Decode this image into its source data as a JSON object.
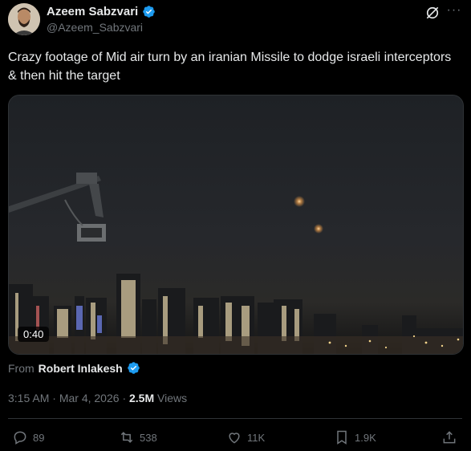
{
  "author": {
    "name": "Azeem Sabzvari",
    "handle": "@Azeem_Sabzvari",
    "verified_icon": "verified-badge-icon",
    "avatar_icon": "avatar"
  },
  "header_actions": {
    "grok_icon": "grok-icon",
    "more_label": "···"
  },
  "tweet": {
    "text": "Crazy footage of Mid air turn by an iranian Missile to dodge israeli interceptors & then hit the target"
  },
  "media": {
    "duration": "0:40"
  },
  "source": {
    "prefix": "From",
    "name": "Robert Inlakesh"
  },
  "meta": {
    "time": "3:15 AM",
    "separator": "·",
    "date": "Mar 4, 2026",
    "views_count": "2.5M",
    "views_label": "Views"
  },
  "actions": {
    "replies": "89",
    "reposts": "538",
    "likes": "11K",
    "bookmarks": "1.9K"
  },
  "colors": {
    "background": "#000000",
    "text": "#e7e9ea",
    "muted": "#71767b",
    "verified": "#1d9bf0",
    "divider": "#2f3336"
  }
}
